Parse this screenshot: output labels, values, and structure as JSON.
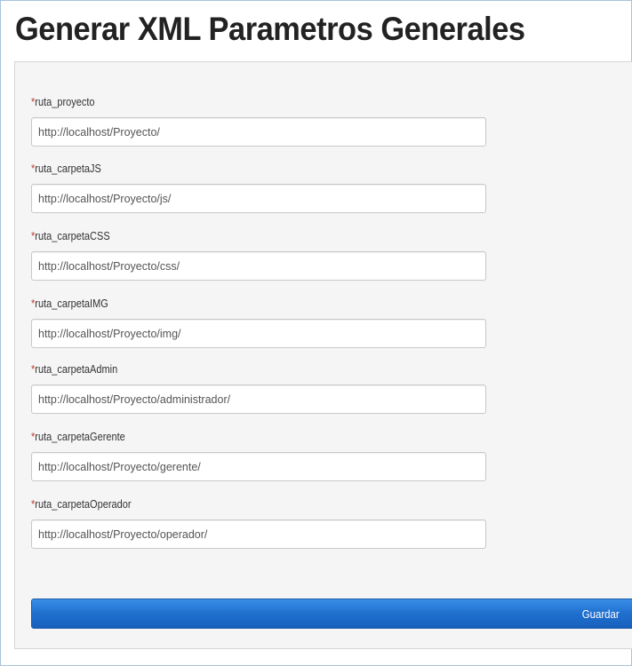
{
  "page": {
    "title": "Generar XML Parametros Generales"
  },
  "form": {
    "required_marker": "*",
    "fields": [
      {
        "label": "ruta_proyecto",
        "value": "http://localhost/Proyecto/"
      },
      {
        "label": "ruta_carpetaJS",
        "value": "http://localhost/Proyecto/js/"
      },
      {
        "label": "ruta_carpetaCSS",
        "value": "http://localhost/Proyecto/css/"
      },
      {
        "label": "ruta_carpetaIMG",
        "value": "http://localhost/Proyecto/img/"
      },
      {
        "label": "ruta_carpetaAdmin",
        "value": "http://localhost/Proyecto/administrador/"
      },
      {
        "label": "ruta_carpetaGerente",
        "value": "http://localhost/Proyecto/gerente/"
      },
      {
        "label": "ruta_carpetaOperador",
        "value": "http://localhost/Proyecto/operador/"
      }
    ],
    "save_label": "Guardar"
  },
  "colors": {
    "required": "#c0392b",
    "button": "#1f6fcf",
    "panel": "#f5f5f5"
  }
}
